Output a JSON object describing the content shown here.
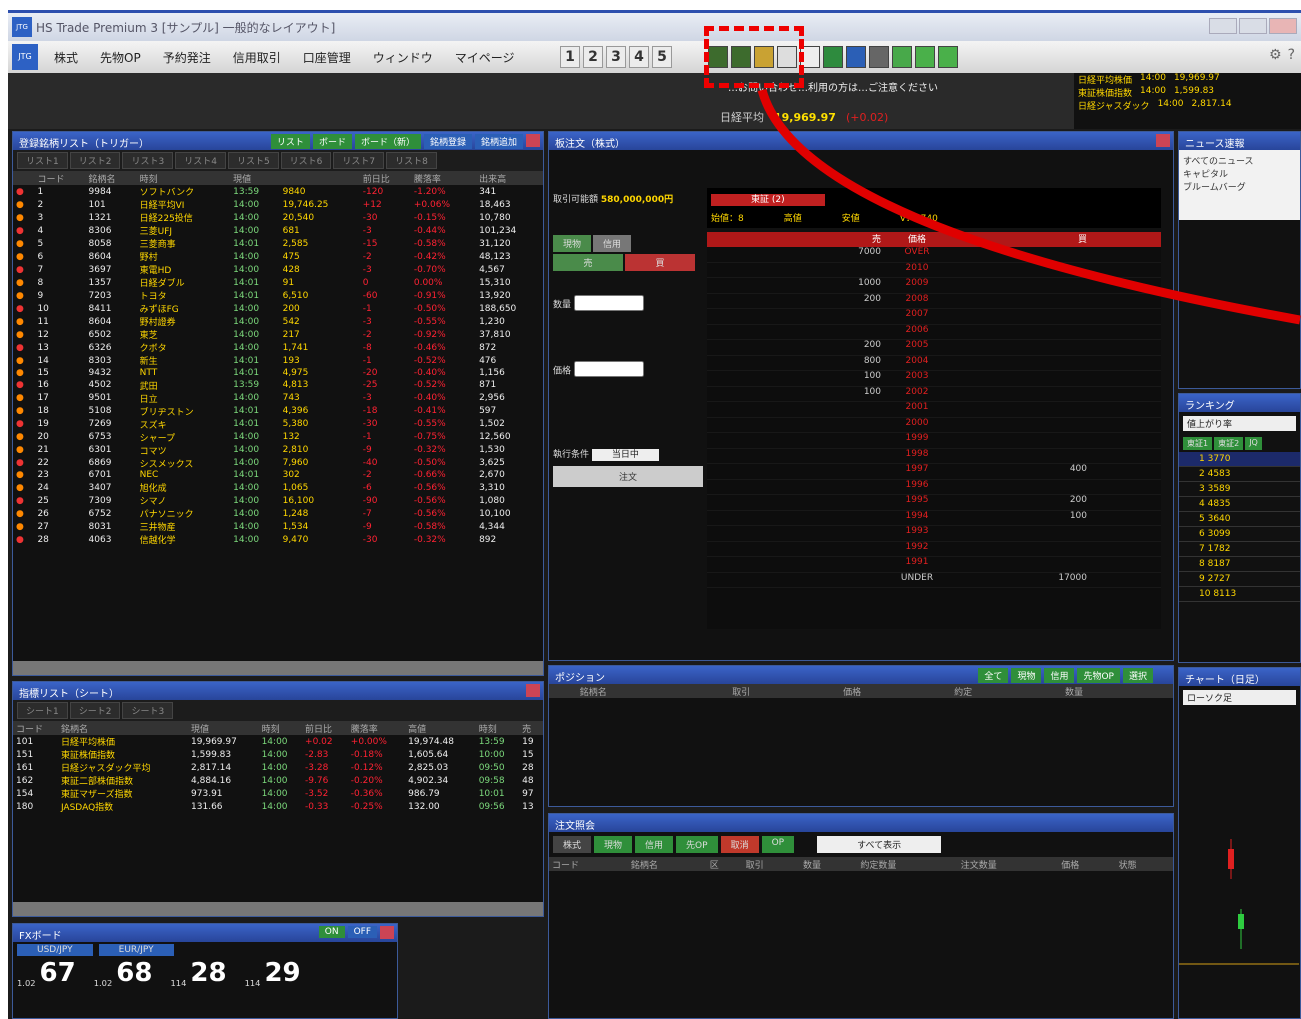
{
  "window": {
    "title": "HS Trade Premium 3 [サンプル] 一般的なレイアウト]",
    "logo": "JTG"
  },
  "menu": {
    "items": [
      "株式",
      "先物OP",
      "予約発注",
      "信用取引",
      "口座管理",
      "ウィンドウ",
      "マイページ"
    ],
    "layout_tabs": [
      "1",
      "2",
      "3",
      "4",
      "5"
    ]
  },
  "ticker": {
    "headline": "…お問い合わせ…利用の方は…ご注意ください",
    "index_label": "日経平均",
    "index_value": "19,969.97",
    "index_change": "(+0.02)"
  },
  "market_index": {
    "rows": [
      [
        "日経平均株価",
        "14:00",
        "19,969.97"
      ],
      [
        "東証株価指数",
        "14:00",
        "1,599.83"
      ],
      [
        "日経ジャスダック",
        "14:00",
        "2,817.14"
      ]
    ]
  },
  "watchlist": {
    "title": "登録銘柄リスト（トリガー）",
    "tabs": [
      "リスト1",
      "リスト2",
      "リスト3",
      "リスト4",
      "リスト5",
      "リスト6",
      "リスト7",
      "リスト8"
    ],
    "buttons": [
      "リスト",
      "ボード",
      "ボード（新）",
      "銘柄登録",
      "銘柄追加"
    ],
    "columns": [
      "",
      "コード",
      "銘柄名",
      "時刻",
      "現値",
      "",
      "前日比",
      "騰落率",
      "出来高"
    ],
    "rows": [
      [
        "1",
        "9984",
        "ソフトバンク",
        "13:59",
        "9840",
        "-120",
        "-1.20%",
        "341"
      ],
      [
        "2",
        "101",
        "日経平均VI",
        "14:00",
        "19,746.25",
        "+12",
        "+0.06%",
        "18,463"
      ],
      [
        "3",
        "1321",
        "日経225投信",
        "14:00",
        "20,540",
        "-30",
        "-0.15%",
        "10,780"
      ],
      [
        "4",
        "8306",
        "三菱UFJ",
        "14:00",
        "681",
        "-3",
        "-0.44%",
        "101,234"
      ],
      [
        "5",
        "8058",
        "三菱商事",
        "14:01",
        "2,585",
        "-15",
        "-0.58%",
        "31,120"
      ],
      [
        "6",
        "8604",
        "野村",
        "14:00",
        "475",
        "-2",
        "-0.42%",
        "48,123"
      ],
      [
        "7",
        "3697",
        "東電HD",
        "14:00",
        "428",
        "-3",
        "-0.70%",
        "4,567"
      ],
      [
        "8",
        "1357",
        "日経ダブル",
        "14:01",
        "91",
        "0",
        "0.00%",
        "15,310"
      ],
      [
        "9",
        "7203",
        "トヨタ",
        "14:01",
        "6,510",
        "-60",
        "-0.91%",
        "13,920"
      ],
      [
        "10",
        "8411",
        "みずほFG",
        "14:00",
        "200",
        "-1",
        "-0.50%",
        "188,650"
      ],
      [
        "11",
        "8604",
        "野村證券",
        "14:00",
        "542",
        "-3",
        "-0.55%",
        "1,230"
      ],
      [
        "12",
        "6502",
        "東芝",
        "14:00",
        "217",
        "-2",
        "-0.92%",
        "37,810"
      ],
      [
        "13",
        "6326",
        "クボタ",
        "14:00",
        "1,741",
        "-8",
        "-0.46%",
        "872"
      ],
      [
        "14",
        "8303",
        "新生",
        "14:01",
        "193",
        "-1",
        "-0.52%",
        "476"
      ],
      [
        "15",
        "9432",
        "NTT",
        "14:01",
        "4,975",
        "-20",
        "-0.40%",
        "1,156"
      ],
      [
        "16",
        "4502",
        "武田",
        "13:59",
        "4,813",
        "-25",
        "-0.52%",
        "871"
      ],
      [
        "17",
        "9501",
        "日立",
        "14:00",
        "743",
        "-3",
        "-0.40%",
        "2,956"
      ],
      [
        "18",
        "5108",
        "ブリヂストン",
        "14:01",
        "4,396",
        "-18",
        "-0.41%",
        "597"
      ],
      [
        "19",
        "7269",
        "スズキ",
        "14:01",
        "5,380",
        "-30",
        "-0.55%",
        "1,502"
      ],
      [
        "20",
        "6753",
        "シャープ",
        "14:00",
        "132",
        "-1",
        "-0.75%",
        "12,560"
      ],
      [
        "21",
        "6301",
        "コマツ",
        "14:00",
        "2,810",
        "-9",
        "-0.32%",
        "1,530"
      ],
      [
        "22",
        "6869",
        "シスメックス",
        "14:00",
        "7,960",
        "-40",
        "-0.50%",
        "3,625"
      ],
      [
        "23",
        "6701",
        "NEC",
        "14:01",
        "302",
        "-2",
        "-0.66%",
        "2,670"
      ],
      [
        "24",
        "3407",
        "旭化成",
        "14:00",
        "1,065",
        "-6",
        "-0.56%",
        "3,310"
      ],
      [
        "25",
        "7309",
        "シマノ",
        "14:00",
        "16,100",
        "-90",
        "-0.56%",
        "1,080"
      ],
      [
        "26",
        "6752",
        "パナソニック",
        "14:00",
        "1,248",
        "-7",
        "-0.56%",
        "10,100"
      ],
      [
        "27",
        "8031",
        "三井物産",
        "14:00",
        "1,534",
        "-9",
        "-0.58%",
        "4,344"
      ],
      [
        "28",
        "4063",
        "信越化学",
        "14:00",
        "9,470",
        "-30",
        "-0.32%",
        "892"
      ]
    ]
  },
  "holdings": {
    "title": "指標リスト（シート）",
    "tabs": [
      "シート1",
      "シート2",
      "シート3"
    ],
    "columns": [
      "コード",
      "銘柄名",
      "現値",
      "時刻",
      "前日比",
      "騰落率",
      "高値",
      "時刻",
      "売"
    ],
    "rows": [
      [
        "101",
        "日経平均株価",
        "19,969.97",
        "14:00",
        "+0.02",
        "+0.00%",
        "19,974.48",
        "13:59",
        "19"
      ],
      [
        "151",
        "東証株価指数",
        "1,599.83",
        "14:00",
        "-2.83",
        "-0.18%",
        "1,605.64",
        "10:00",
        "15"
      ],
      [
        "161",
        "日経ジャスダック平均",
        "2,817.14",
        "14:00",
        "-3.28",
        "-0.12%",
        "2,825.03",
        "09:50",
        "28"
      ],
      [
        "162",
        "東証二部株価指数",
        "4,884.16",
        "14:00",
        "-9.76",
        "-0.20%",
        "4,902.34",
        "09:58",
        "48"
      ],
      [
        "154",
        "東証マザーズ指数",
        "973.91",
        "14:00",
        "-3.52",
        "-0.36%",
        "986.79",
        "10:01",
        "97"
      ],
      [
        "180",
        "JASDAQ指数",
        "131.66",
        "14:00",
        "-0.33",
        "-0.25%",
        "132.00",
        "09:56",
        "13"
      ]
    ]
  },
  "fx": {
    "title": "FXボード",
    "pairs": [
      "USD/JPY",
      "EUR/JPY"
    ],
    "buttons": [
      "ON",
      "OFF"
    ],
    "quotes": [
      "1.02",
      "67",
      "1.02",
      "68",
      "114",
      "28",
      "114",
      "29"
    ]
  },
  "order": {
    "title": "板注文（株式）",
    "tabs": [
      "現物",
      "信用",
      "売",
      "買"
    ],
    "account_label": "取引可能額",
    "account_value": "580,000,000円",
    "market": "東証",
    "order_btn": "注文",
    "qty_label": "数量",
    "price_label": "価格",
    "exec_label": "執行条件",
    "exec_value": "当日中"
  },
  "board": {
    "header": "東証 (2)",
    "stats": {
      "open": "始値：8",
      "high": "高値",
      "low": "安値",
      "volume": "V：3740"
    },
    "cols": [
      "売",
      "価格",
      "買"
    ],
    "over": "OVER",
    "under": "UNDER",
    "under_qty": "17000",
    "rows": [
      [
        "7000",
        "OVER",
        ""
      ],
      [
        "",
        "2010",
        ""
      ],
      [
        "1000",
        "2009",
        ""
      ],
      [
        "200",
        "2008",
        ""
      ],
      [
        "",
        "2007",
        ""
      ],
      [
        "",
        "2006",
        ""
      ],
      [
        "200",
        "2005",
        ""
      ],
      [
        "800",
        "2004",
        ""
      ],
      [
        "100",
        "2003",
        ""
      ],
      [
        "100",
        "2002",
        ""
      ],
      [
        "",
        "2001",
        ""
      ],
      [
        "",
        "2000",
        ""
      ],
      [
        "",
        "1999",
        ""
      ],
      [
        "",
        "1998",
        ""
      ],
      [
        "",
        "1997",
        "400"
      ],
      [
        "",
        "1996",
        ""
      ],
      [
        "",
        "1995",
        "200"
      ],
      [
        "",
        "1994",
        "100"
      ],
      [
        "",
        "1993",
        ""
      ],
      [
        "",
        "1992",
        ""
      ],
      [
        "",
        "1991",
        ""
      ]
    ]
  },
  "positions": {
    "title": "ポジション",
    "buttons": [
      "全て",
      "現物",
      "信用",
      "先物OP",
      "選択"
    ],
    "columns": [
      "",
      "銘柄名",
      "取引",
      "価格",
      "約定",
      "数量"
    ]
  },
  "orders": {
    "title": "注文照会",
    "buttons": [
      "株式",
      "現物",
      "信用",
      "先OP",
      "取消",
      "OP"
    ],
    "filter": "すべて表示",
    "columns": [
      "コード",
      "銘柄名",
      "区",
      "取引",
      "数量",
      "約定数量",
      "注文数量",
      "価格",
      "状態"
    ]
  },
  "news": {
    "title": "ニュース速報",
    "items": [
      "すべてのニュース",
      "キャピタル",
      "ブルームバーグ"
    ]
  },
  "ranking": {
    "title": "ランキング",
    "type": "値上がり率",
    "tabs": [
      "東証1",
      "東証2",
      "JQ"
    ],
    "items": [
      "1 3770",
      "2 4583",
      "3 3589",
      "4 4835",
      "5 3640",
      "6 3099",
      "7 1782",
      "8 8187",
      "9 2727",
      "10 8113"
    ]
  },
  "chart": {
    "title": "チャート（日足）",
    "type": "ローソク足",
    "period": "日足"
  },
  "callout": {
    "color": "#e00000"
  }
}
